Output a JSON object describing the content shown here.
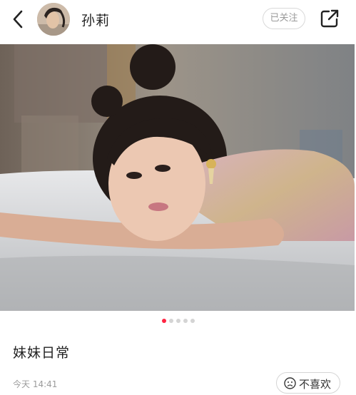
{
  "header": {
    "back_icon": "chevron-left-icon",
    "author_name": "孙莉",
    "follow_label": "已关注",
    "share_icon": "share-external-icon"
  },
  "carousel": {
    "total": 5,
    "active_index": 0,
    "active_color": "#ff2442",
    "inactive_color": "#d4d4d4"
  },
  "post": {
    "title": "妹妹日常",
    "time": "今天 14:41",
    "dislike_label": "不喜欢",
    "dislike_icon": "sad-face-icon"
  }
}
